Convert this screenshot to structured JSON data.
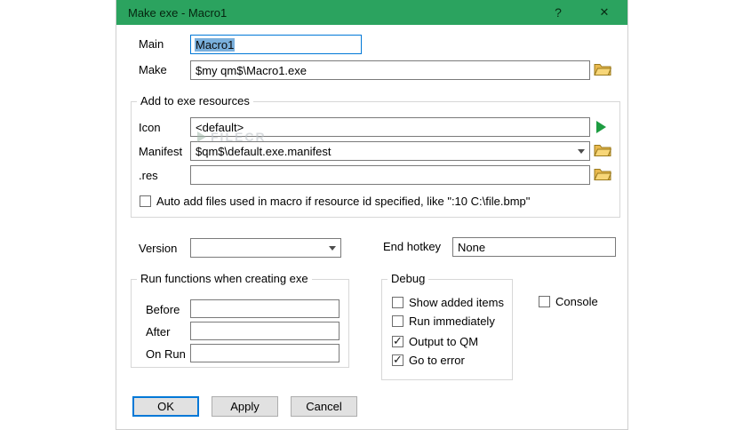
{
  "window": {
    "title": "Make exe - Macro1",
    "help_label": "?",
    "close_icon": "✕"
  },
  "colors": {
    "titlebar_green": "#2ba35f",
    "default_button_border": "#0078d7",
    "selection_blue": "#7ab0dd",
    "folder_yellow": "#f5cf6e"
  },
  "main_field": {
    "label": "Main",
    "value": "Macro1"
  },
  "make_field": {
    "label": "Make",
    "value": "$my qm$\\Macro1.exe"
  },
  "resources_group": {
    "title": "Add to exe resources",
    "icon_field": {
      "label": "Icon",
      "value": "<default>"
    },
    "manifest_field": {
      "label": "Manifest",
      "value": "$qm$\\default.exe.manifest"
    },
    "res_field": {
      "label": ".res",
      "value": ""
    },
    "auto_add_checkbox": {
      "label": "Auto add files used in macro if resource id specified, like \":10 C:\\file.bmp\"",
      "checked": false
    }
  },
  "version_field": {
    "label": "Version",
    "value": ""
  },
  "end_hotkey_field": {
    "label": "End hotkey",
    "value": "None"
  },
  "run_functions_group": {
    "title": "Run functions when creating exe",
    "before_field": {
      "label": "Before",
      "value": ""
    },
    "after_field": {
      "label": "After",
      "value": ""
    },
    "on_run_field": {
      "label": "On Run",
      "value": ""
    }
  },
  "debug_group": {
    "title": "Debug",
    "checkboxes": [
      {
        "label": "Show added items",
        "checked": false
      },
      {
        "label": "Run immediately",
        "checked": false
      },
      {
        "label": "Output to QM",
        "checked": true
      },
      {
        "label": "Go to error",
        "checked": true
      }
    ]
  },
  "console_checkbox": {
    "label": "Console",
    "checked": false
  },
  "buttons": {
    "ok": "OK",
    "apply": "Apply",
    "cancel": "Cancel"
  },
  "watermark": {
    "text": "FILECR"
  }
}
